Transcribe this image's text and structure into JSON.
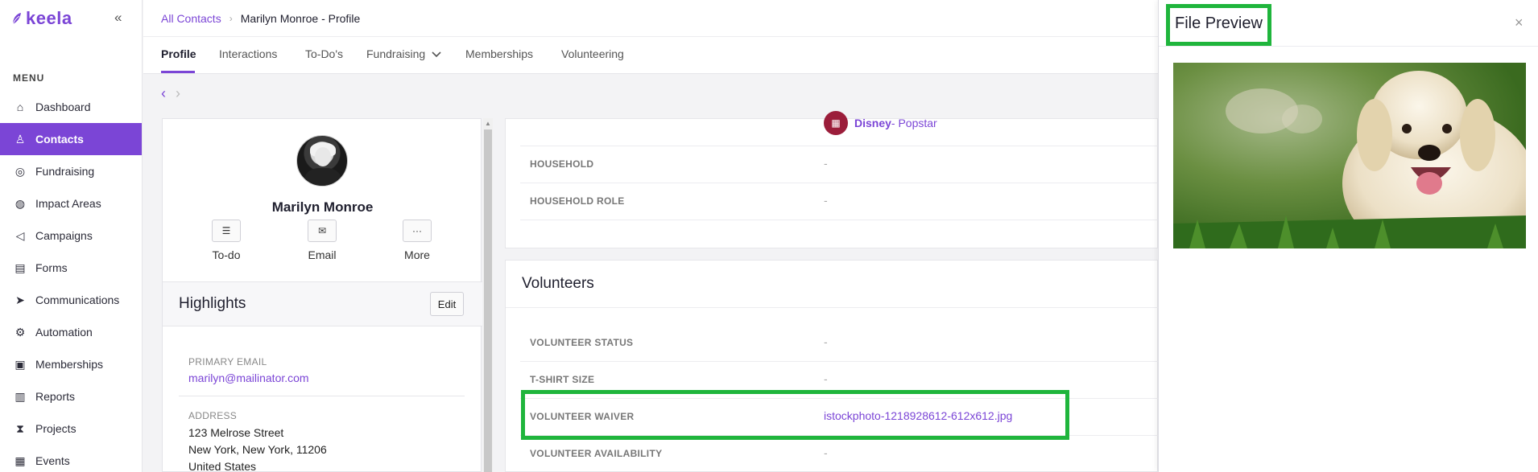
{
  "app": {
    "logo_text": "keela",
    "collapse_glyph": "«"
  },
  "sidebar": {
    "menu_label": "MENU",
    "items": [
      {
        "label": "Dashboard",
        "icon": "home-icon",
        "glyph": "⌂"
      },
      {
        "label": "Contacts",
        "icon": "user-icon",
        "glyph": "♙",
        "active": true
      },
      {
        "label": "Fundraising",
        "icon": "hand-coin-icon",
        "glyph": "◎"
      },
      {
        "label": "Impact Areas",
        "icon": "globe-icon",
        "glyph": "◍"
      },
      {
        "label": "Campaigns",
        "icon": "megaphone-icon",
        "glyph": "◁"
      },
      {
        "label": "Forms",
        "icon": "form-icon",
        "glyph": "▤"
      },
      {
        "label": "Communications",
        "icon": "send-icon",
        "glyph": "➤"
      },
      {
        "label": "Automation",
        "icon": "robot-icon",
        "glyph": "⚙"
      },
      {
        "label": "Memberships",
        "icon": "id-card-icon",
        "glyph": "▣"
      },
      {
        "label": "Reports",
        "icon": "bar-chart-icon",
        "glyph": "▥"
      },
      {
        "label": "Projects",
        "icon": "hourglass-icon",
        "glyph": "⧗"
      },
      {
        "label": "Events",
        "icon": "calendar-icon",
        "glyph": "▦"
      }
    ]
  },
  "breadcrumb": {
    "parent": "All Contacts",
    "separator": "›",
    "current": "Marilyn Monroe - Profile"
  },
  "tabs": [
    {
      "label": "Profile",
      "active": true
    },
    {
      "label": "Interactions"
    },
    {
      "label": "To-Do's"
    },
    {
      "label": "Fundraising",
      "has_dropdown": true
    },
    {
      "label": "Memberships"
    },
    {
      "label": "Volunteering"
    }
  ],
  "pager": {
    "prev": "‹",
    "next": "›"
  },
  "profile": {
    "name": "Marilyn Monroe",
    "actions": [
      {
        "label": "To-do",
        "icon": "checklist-icon",
        "glyph": "☰"
      },
      {
        "label": "Email",
        "icon": "envelope-icon",
        "glyph": "✉"
      },
      {
        "label": "More",
        "icon": "more-icon",
        "glyph": "···"
      }
    ],
    "highlights_title": "Highlights",
    "edit_label": "Edit",
    "primary_email_label": "PRIMARY EMAIL",
    "primary_email": "marilyn@mailinator.com",
    "address_label": "ADDRESS",
    "address_line1": "123 Melrose Street",
    "address_line2": "New York, New York, 11206",
    "address_line3": "United States"
  },
  "details": {
    "org_name": "Disney",
    "org_role": "- Popstar",
    "household_label": "HOUSEHOLD",
    "household_value": "-",
    "household_role_label": "HOUSEHOLD ROLE",
    "household_role_value": "-"
  },
  "volunteers": {
    "title": "Volunteers",
    "status_label": "VOLUNTEER STATUS",
    "status_value": "-",
    "tshirt_label": "T-SHIRT SIZE",
    "tshirt_value": "-",
    "waiver_label": "VOLUNTEER WAIVER",
    "waiver_file": "istockphoto-1218928612-612x612.jpg",
    "availability_label": "VOLUNTEER AVAILABILITY",
    "availability_value": "-"
  },
  "preview": {
    "title": "File Preview",
    "close": "×"
  },
  "colors": {
    "accent": "#7b45d6",
    "highlight": "#1fb53c",
    "org_badge": "#9b1d3a"
  }
}
